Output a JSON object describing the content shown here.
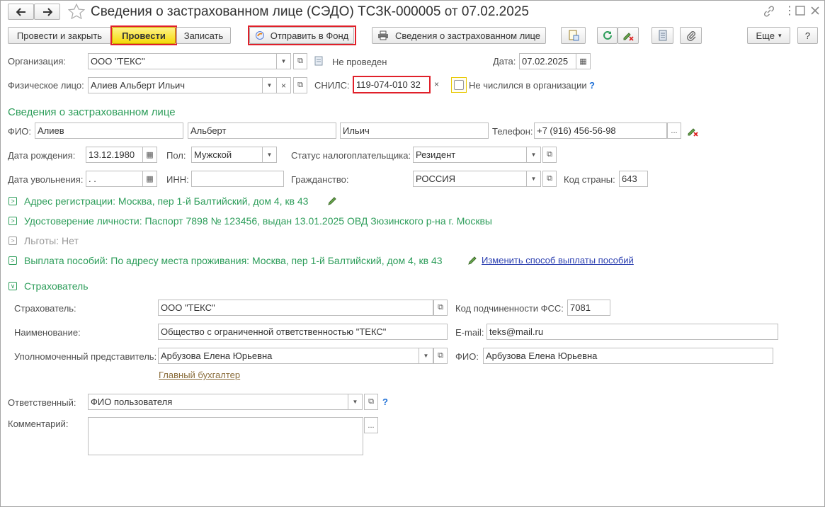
{
  "title": "Сведения о застрахованном лице (СЭДО) ТСЗК-000005 от 07.02.2025",
  "toolbar": {
    "post_close": "Провести и закрыть",
    "post": "Провести",
    "save": "Записать",
    "send_fund": "Отправить в Фонд",
    "print_info": "Сведения о застрахованном лице",
    "more": "Еще",
    "more_arrow": "▾",
    "help": "?"
  },
  "header": {
    "org_label": "Организация:",
    "org_value": "ООО \"ТЕКС\"",
    "status": "Не проведен",
    "date_label": "Дата:",
    "date_value": "07.02.2025",
    "person_label": "Физическое лицо:",
    "person_value": "Алиев Альберт Ильич",
    "snils_label": "СНИЛС:",
    "snils_value": "119-074-010 32",
    "not_listed_label": "Не числился в организации",
    "help": "?"
  },
  "insured": {
    "section_title": "Сведения о застрахованном лице",
    "fio_label": "ФИО:",
    "last_name": "Алиев",
    "first_name": "Альберт",
    "middle_name": "Ильич",
    "phone_label": "Телефон:",
    "phone_value": "+7 (916) 456-56-98",
    "birth_label": "Дата рождения:",
    "birth_value": "13.12.1980",
    "gender_label": "Пол:",
    "gender_value": "Мужской",
    "tax_status_label": "Статус налогоплательщика:",
    "tax_status_value": "Резидент",
    "dismissal_label": "Дата увольнения:",
    "dismissal_value": " .  .",
    "inn_label": "ИНН:",
    "inn_value": "",
    "citizenship_label": "Гражданство:",
    "citizenship_value": "РОССИЯ",
    "country_code_label": "Код страны:",
    "country_code_value": "643"
  },
  "groups": {
    "address": "Адрес регистрации: Москва, пер 1-й Балтийский, дом 4, кв 43",
    "identity": "Удостоверение личности: Паспорт 7898 № 123456, выдан 13.01.2025 ОВД Зюзинского р-на г. Москвы",
    "benefits": "Льготы: Нет",
    "payment": "Выплата пособий: По адресу места проживания: Москва, пер 1-й Балтийский, дом 4, кв 43",
    "payment_link": "Изменить способ выплаты пособий"
  },
  "insurer": {
    "section_title": "Страхователь",
    "insurer_label": "Страхователь:",
    "insurer_value": "ООО \"ТЕКС\"",
    "fss_code_label": "Код подчиненности ФСС:",
    "fss_code_value": "7081",
    "name_label": "Наименование:",
    "name_value": "Общество с ограниченной ответственностью \"ТЕКС\"",
    "email_label": "E-mail:",
    "email_value": "teks@mail.ru",
    "rep_label": "Уполномоченный представитель:",
    "rep_value": "Арбузова Елена Юрьевна",
    "rep_fio_label": "ФИО:",
    "rep_fio_value": "Арбузова Елена Юрьевна",
    "chief_link": "Главный бухгалтер"
  },
  "footer": {
    "responsible_label": "Ответственный:",
    "responsible_value": "ФИО пользователя",
    "comment_label": "Комментарий:",
    "comment_value": "",
    "help": "?"
  },
  "colors": {
    "accent_green": "#2d9d5a",
    "highlight_red": "#e0202a",
    "post_yellow": "#f5d90a",
    "link_blue": "#2b3fb0"
  }
}
